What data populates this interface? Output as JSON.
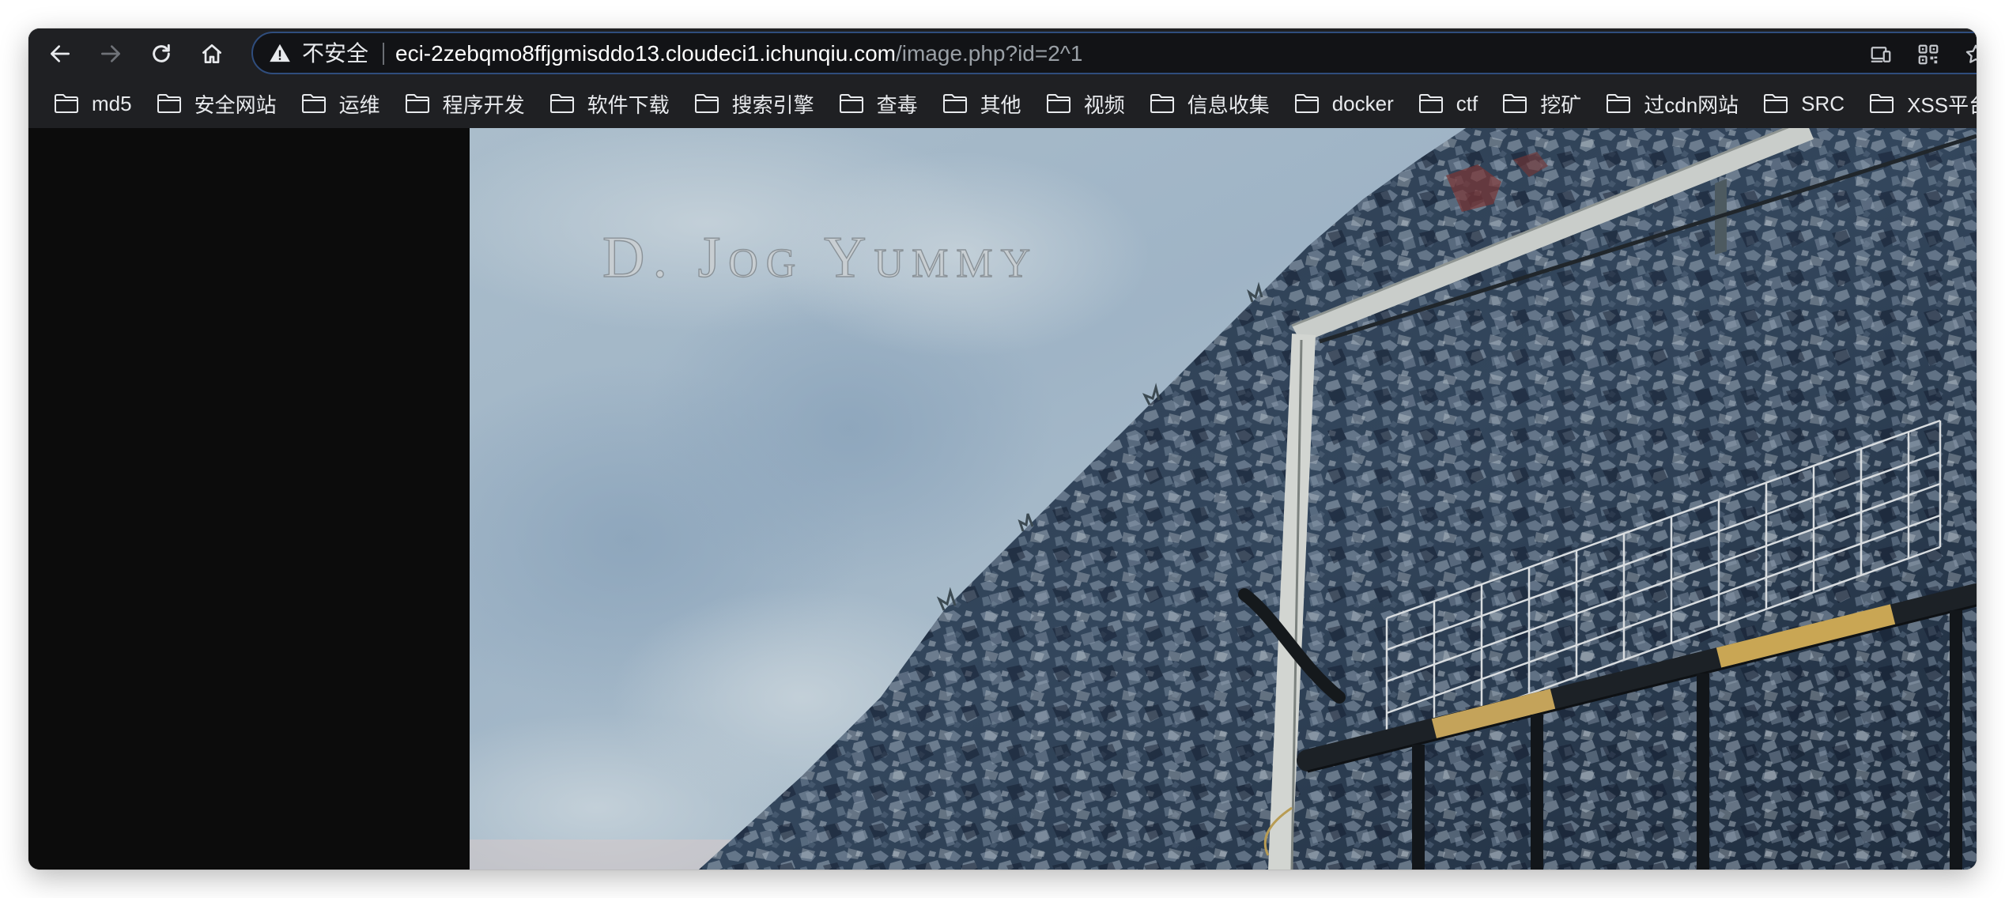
{
  "nav": {
    "back_icon": "arrow-left-icon",
    "forward_icon": "arrow-right-icon",
    "reload_icon": "reload-icon",
    "home_icon": "home-icon"
  },
  "address_bar": {
    "security_icon": "warning-triangle-icon",
    "security_label": "不安全",
    "url_host": "eci-2zebqmo8ffjgmisddo13.cloudeci1.ichunqiu.com",
    "url_path": "/image.php?id=2^1"
  },
  "bookmarks": [
    {
      "label": "md5",
      "icon": "folder-icon"
    },
    {
      "label": "安全网站",
      "icon": "folder-icon"
    },
    {
      "label": "运维",
      "icon": "folder-icon"
    },
    {
      "label": "程序开发",
      "icon": "folder-icon"
    },
    {
      "label": "软件下载",
      "icon": "folder-icon"
    },
    {
      "label": "搜索引擎",
      "icon": "folder-icon"
    },
    {
      "label": "查毒",
      "icon": "folder-icon"
    },
    {
      "label": "其他",
      "icon": "folder-icon"
    },
    {
      "label": "视频",
      "icon": "folder-icon"
    },
    {
      "label": "信息收集",
      "icon": "folder-icon"
    },
    {
      "label": "docker",
      "icon": "folder-icon"
    },
    {
      "label": "ctf",
      "icon": "folder-icon"
    },
    {
      "label": "挖矿",
      "icon": "folder-icon"
    },
    {
      "label": "过cdn网站",
      "icon": "folder-icon"
    },
    {
      "label": "SRC",
      "icon": "folder-icon"
    },
    {
      "label": "XSS平台",
      "icon": "folder-icon"
    }
  ],
  "image": {
    "overlay_text": "D. Jog Yummy"
  },
  "colors": {
    "toolbar_bg": "#1f2023",
    "omnibox_bg": "#121316",
    "omnibox_border": "#2f4d7d",
    "page_bg": "#0c0c0c",
    "text_primary": "#e8eaed",
    "text_secondary": "#9aa0a6"
  }
}
